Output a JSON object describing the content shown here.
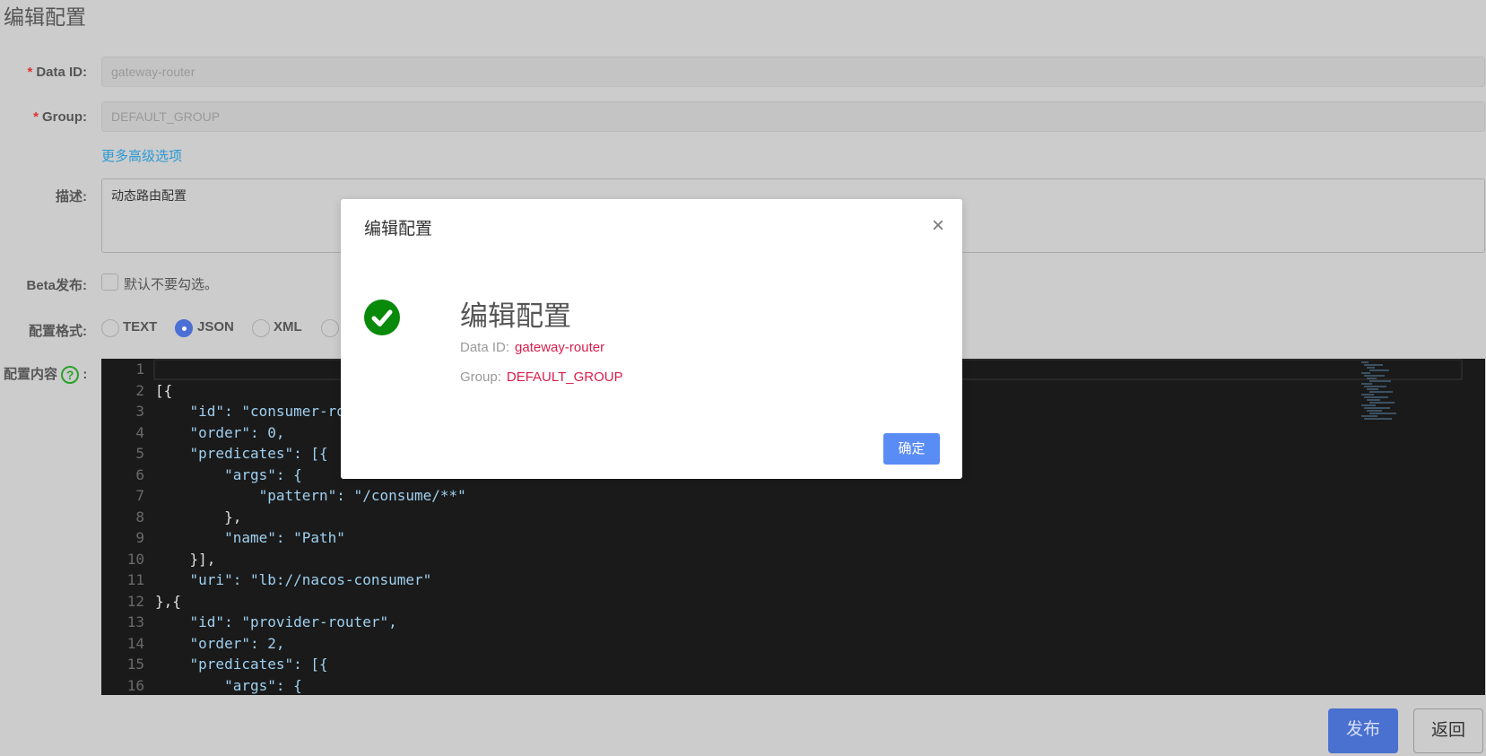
{
  "page_title": "编辑配置",
  "form": {
    "data_id": {
      "label": "Data ID:",
      "value": "gateway-router"
    },
    "group": {
      "label": "Group:",
      "value": "DEFAULT_GROUP"
    },
    "advanced_link": "更多高级选项",
    "description": {
      "label": "描述:",
      "value": "动态路由配置"
    },
    "beta": {
      "label": "Beta发布:",
      "hint": "默认不要勾选。",
      "checked": false
    },
    "format": {
      "label": "配置格式:",
      "options": [
        "TEXT",
        "JSON",
        "XML"
      ],
      "selected": "JSON"
    },
    "content_label": "配置内容",
    "help_icon": "?"
  },
  "editor": {
    "lines": [
      "",
      "[{",
      "    \"id\": \"consumer-router\",",
      "    \"order\": 0,",
      "    \"predicates\": [{",
      "        \"args\": {",
      "            \"pattern\": \"/consume/**\"",
      "        },",
      "        \"name\": \"Path\"",
      "    }],",
      "    \"uri\": \"lb://nacos-consumer\"",
      "},{",
      "    \"id\": \"provider-router\",",
      "    \"order\": 2,",
      "    \"predicates\": [{",
      "        \"args\": {"
    ]
  },
  "buttons": {
    "publish": "发布",
    "back": "返回"
  },
  "modal": {
    "title": "编辑配置",
    "close_icon": "×",
    "heading": "编辑配置",
    "data_id_label": "Data ID:",
    "data_id_value": "gateway-router",
    "group_label": "Group:",
    "group_value": "DEFAULT_GROUP",
    "ok": "确定",
    "success_color": "#0a8a0a"
  }
}
